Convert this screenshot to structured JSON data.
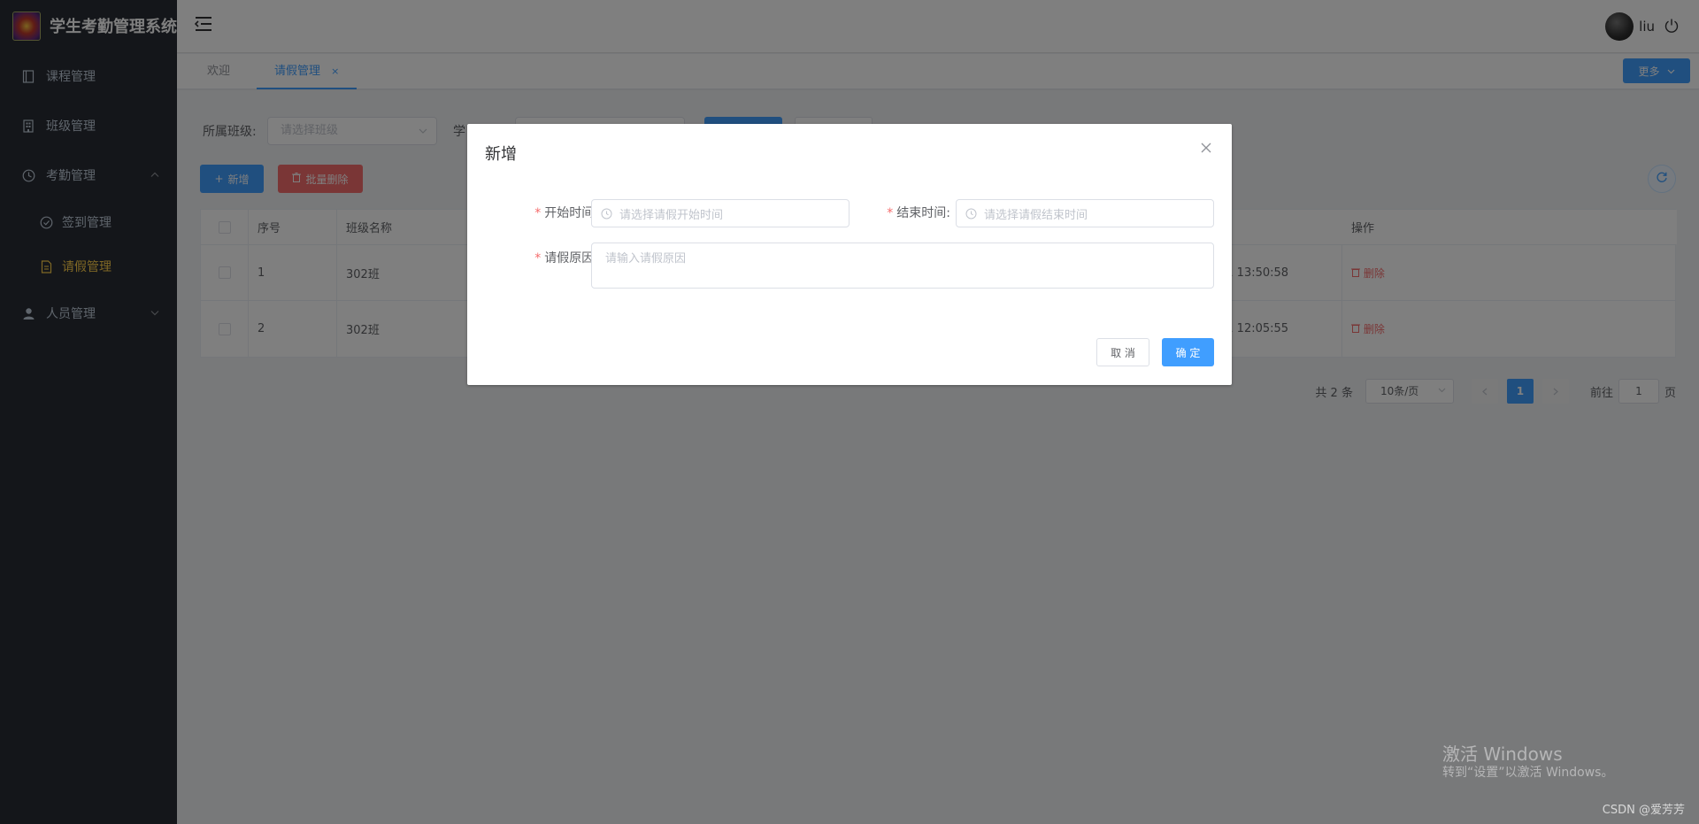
{
  "app": {
    "title": "学生考勤管理系统"
  },
  "sidebar": {
    "items": [
      {
        "label": "课程管理",
        "icon": "book-icon"
      },
      {
        "label": "班级管理",
        "icon": "building-icon"
      },
      {
        "label": "考勤管理",
        "icon": "clock-icon",
        "expanded": true,
        "children": [
          {
            "label": "签到管理",
            "icon": "check-circle-icon"
          },
          {
            "label": "请假管理",
            "icon": "document-icon",
            "active": true
          }
        ]
      },
      {
        "label": "人员管理",
        "icon": "user-icon"
      }
    ]
  },
  "header": {
    "username": "liu"
  },
  "tabs": {
    "items": [
      {
        "label": "欢迎"
      },
      {
        "label": "请假管理",
        "active": true,
        "closable": true,
        "close": "×"
      }
    ],
    "more_label": "更多"
  },
  "main": {
    "filter": {
      "class_label": "所属班级:",
      "class_placeholder": "请选择班级",
      "student_label_partial": "学"
    },
    "toolbar": {
      "add_label": "新增",
      "batch_delete_label": "批量删除"
    },
    "table": {
      "headers": [
        "序号",
        "班级名称",
        "操作"
      ],
      "rows": [
        {
          "index": "1",
          "class_name": "302班",
          "time": "01 13:50:58",
          "action": "删除"
        },
        {
          "index": "2",
          "class_name": "302班",
          "time": "01 12:05:55",
          "action": "删除"
        }
      ]
    },
    "pagination": {
      "total_text": "共 2 条",
      "page_size": "10条/页",
      "current_page": "1",
      "goto_prefix": "前往",
      "goto_value": "1",
      "goto_suffix": "页"
    }
  },
  "dialog": {
    "title": "新增",
    "start_label": "开始时间:",
    "start_placeholder": "请选择请假开始时间",
    "end_label": "结束时间:",
    "end_placeholder": "请选择请假结束时间",
    "reason_label": "请假原因:",
    "reason_placeholder": "请输入请假原因",
    "required_mark": "*",
    "cancel_label": "取 消",
    "confirm_label": "确 定"
  },
  "watermark": {
    "line1": "激活 Windows",
    "line2": "转到“设置”以激活 Windows。"
  },
  "credit": "CSDN @爱芳芳",
  "colors": {
    "primary": "#409eff",
    "danger": "#f56c6c",
    "sidebar_bg": "#282c34",
    "active_menu": "#ffd04b"
  }
}
